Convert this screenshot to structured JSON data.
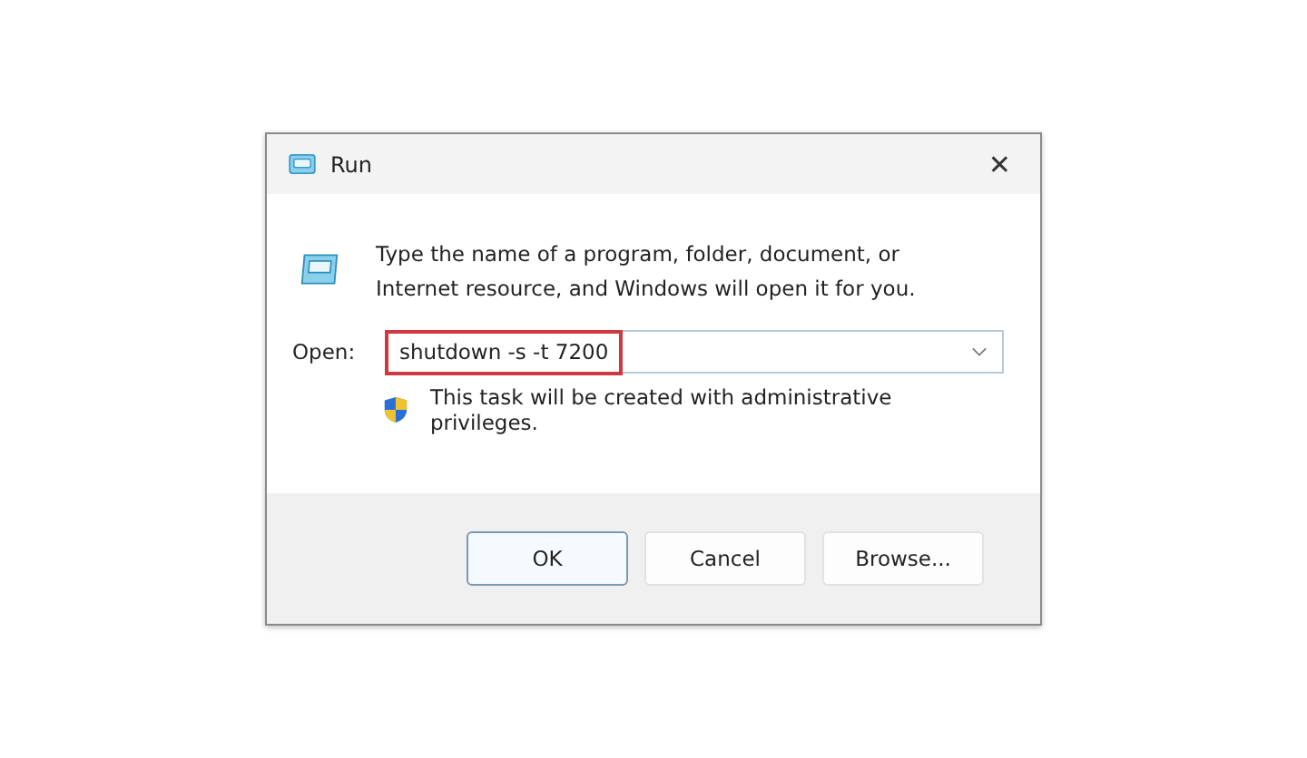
{
  "window": {
    "title": "Run",
    "close_glyph": "✕"
  },
  "description": "Type the name of a program, folder, document, or Internet resource, and Windows will open it for you.",
  "open_field": {
    "label": "Open:",
    "value": "shutdown -s -t 7200",
    "highlighted": true
  },
  "notice": "This task will be created with administrative privileges.",
  "buttons": [
    {
      "label": "OK",
      "default": true
    },
    {
      "label": "Cancel",
      "default": false
    },
    {
      "label": "Browse...",
      "default": false
    }
  ]
}
